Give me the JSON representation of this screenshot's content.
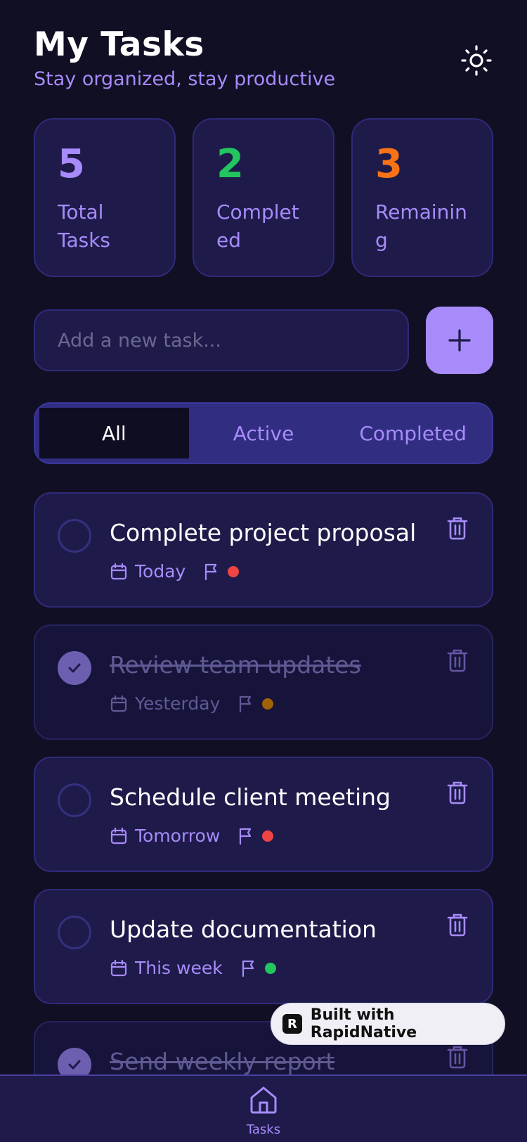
{
  "header": {
    "title": "My Tasks",
    "subtitle": "Stay organized, stay productive",
    "theme_icon": "sun-icon"
  },
  "stats": [
    {
      "value": "5",
      "label": "Total Tasks",
      "color": "#a78bfa"
    },
    {
      "value": "2",
      "label": "Completed",
      "color": "#22c55e"
    },
    {
      "value": "3",
      "label": "Remaining",
      "color": "#f97316"
    }
  ],
  "add": {
    "placeholder": "Add a new task...",
    "button_icon": "plus-icon"
  },
  "tabs": [
    {
      "label": "All",
      "active": true
    },
    {
      "label": "Active",
      "active": false
    },
    {
      "label": "Completed",
      "active": false
    }
  ],
  "tasks": [
    {
      "title": "Complete project proposal",
      "date": "Today",
      "priority_color": "#ef4444",
      "completed": false
    },
    {
      "title": "Review team updates",
      "date": "Yesterday",
      "priority_color": "#a16207",
      "completed": true
    },
    {
      "title": "Schedule client meeting",
      "date": "Tomorrow",
      "priority_color": "#ef4444",
      "completed": false
    },
    {
      "title": "Update documentation",
      "date": "This week",
      "priority_color": "#22c55e",
      "completed": false
    },
    {
      "title": "Send weekly report",
      "date": "",
      "priority_color": "",
      "completed": true
    }
  ],
  "badge": {
    "text": "Built with RapidNative"
  },
  "nav": {
    "items": [
      {
        "label": "Tasks",
        "icon": "home-icon"
      }
    ]
  },
  "colors": {
    "accent": "#a78bfa",
    "background": "#110f24",
    "card": "#1e1b4b"
  }
}
